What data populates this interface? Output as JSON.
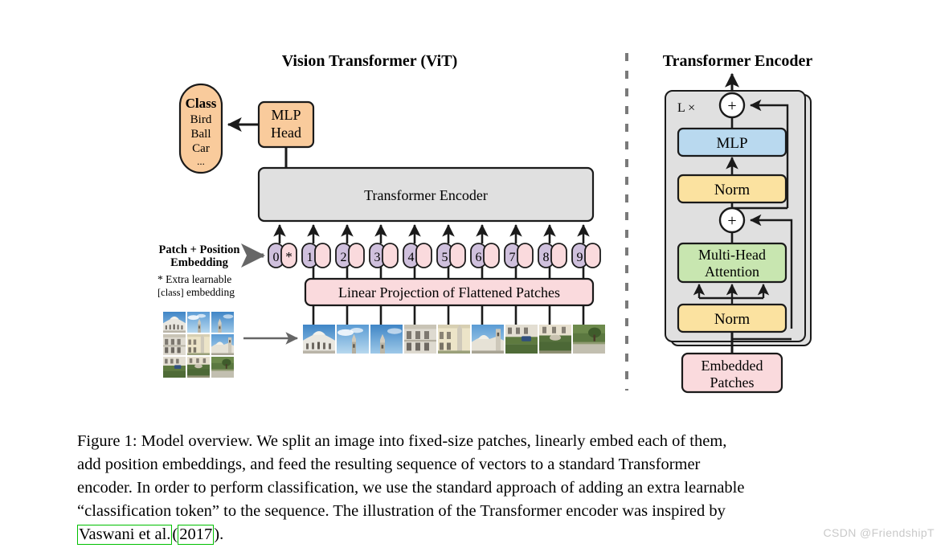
{
  "figure": {
    "left_title": "Vision Transformer (ViT)",
    "right_title": "Transformer Encoder"
  },
  "vit": {
    "class_box": {
      "heading": "Class",
      "items": [
        "Bird",
        "Ball",
        "Car",
        "..."
      ]
    },
    "mlp_head": {
      "line1": "MLP",
      "line2": "Head"
    },
    "encoder_box": {
      "label": "Transformer Encoder"
    },
    "linear_projection": {
      "label": "Linear Projection of Flattened Patches"
    },
    "patch_position_label": {
      "line1": "Patch + Position",
      "line2": "Embedding"
    },
    "extra_learnable": {
      "line1_prefix": "* Extra learnable",
      "line2_mono": "[class]",
      "line2_suffix": " embedding"
    },
    "tokens": [
      {
        "index": "0",
        "star": "*"
      },
      {
        "index": "1",
        "star": ""
      },
      {
        "index": "2",
        "star": ""
      },
      {
        "index": "3",
        "star": ""
      },
      {
        "index": "4",
        "star": ""
      },
      {
        "index": "5",
        "star": ""
      },
      {
        "index": "6",
        "star": ""
      },
      {
        "index": "7",
        "star": ""
      },
      {
        "index": "8",
        "star": ""
      },
      {
        "index": "9",
        "star": ""
      }
    ]
  },
  "encoder": {
    "repeat_label": "L ×",
    "blocks": {
      "mlp": "MLP",
      "norm_top": "Norm",
      "attention_line1": "Multi-Head",
      "attention_line2": "Attention",
      "norm_bottom": "Norm",
      "embedded_patches_line1": "Embedded",
      "embedded_patches_line2": "Patches"
    },
    "add_symbol": "+"
  },
  "caption": {
    "lines": [
      "Figure 1: Model overview. We split an image into fixed-size patches, linearly embed each of them,",
      "add position embeddings, and feed the resulting sequence of vectors to a standard Transformer",
      "encoder. In order to perform classification, we use the standard approach of adding an extra learnable",
      "“classification token” to the sequence. The illustration of the Transformer encoder was inspired by"
    ],
    "citation_author": "Vaswani et al.",
    "citation_open_paren": "(",
    "citation_year": "2017",
    "citation_close_paren": ").",
    "citation_box_color": "#00c000"
  },
  "watermark": {
    "text": "CSDN @FriendshipT"
  },
  "colors": {
    "orange": "#f9cb9c",
    "pink": "#fadadd",
    "purple": "#cfc0dd",
    "gray_box": "#e0e0e0",
    "gray_inner": "#e2e2e2",
    "blue": "#b9d9ef",
    "yellow": "#fbe2a0",
    "green": "#c8e6b0",
    "stroke": "#1a1a1a"
  }
}
